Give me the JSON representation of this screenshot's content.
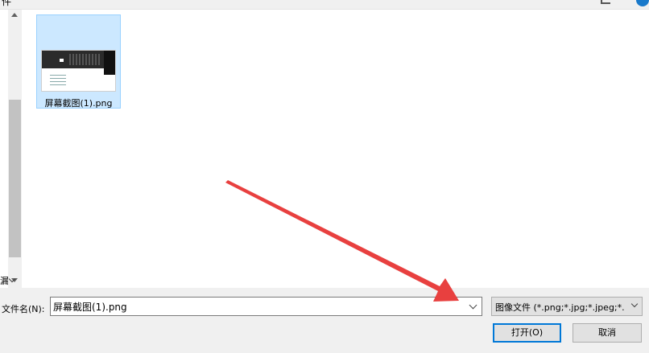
{
  "dialog": {
    "title_fragment": "件"
  },
  "nav_pane": {
    "cut_label": "漏"
  },
  "file_view": {
    "items": [
      {
        "name": "屏幕截图(1).png",
        "selected": true
      }
    ]
  },
  "footer": {
    "filename_label": "文件名(N):",
    "filename_value": "屏幕截图(1).png",
    "filetype_value": "图像文件 (*.png;*.jpg;*.jpeg;*.",
    "open_button": "打开(O)",
    "cancel_button": "取消"
  },
  "icons": {
    "view": "view-options-icon",
    "help": "help-icon",
    "arrow": "red-arrow-annotation"
  },
  "colors": {
    "selection_bg": "#cce8ff",
    "selection_border": "#99d1ff",
    "primary_button_border": "#0078d7",
    "arrow": "#e8403f"
  }
}
